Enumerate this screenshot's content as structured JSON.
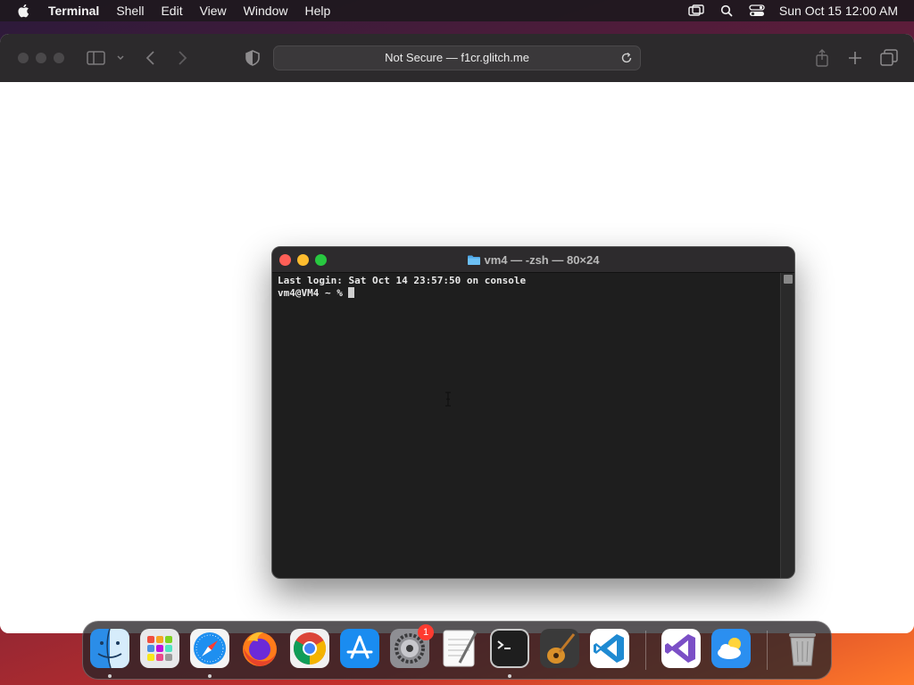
{
  "menubar": {
    "app_name": "Terminal",
    "menus": [
      "Shell",
      "Edit",
      "View",
      "Window",
      "Help"
    ],
    "clock": "Sun Oct 15  12:00 AM",
    "tray_icons": [
      "screen-mirroring-icon",
      "spotlight-icon",
      "control-center-icon"
    ]
  },
  "browser": {
    "address": "Not Secure — f1cr.glitch.me"
  },
  "terminal": {
    "title": "vm4 — -zsh — 80×24",
    "lines": [
      "Last login: Sat Oct 14 23:57:50 on console",
      "vm4@VM4 ~ % "
    ]
  },
  "dock": {
    "apps": [
      {
        "name": "Finder",
        "icon": "finder-icon",
        "running": true
      },
      {
        "name": "Launchpad",
        "icon": "launchpad-icon",
        "running": false
      },
      {
        "name": "Safari",
        "icon": "safari-icon",
        "running": true
      },
      {
        "name": "Firefox",
        "icon": "firefox-icon",
        "running": false
      },
      {
        "name": "Google Chrome",
        "icon": "chrome-icon",
        "running": false
      },
      {
        "name": "App Store",
        "icon": "app-store-icon",
        "running": false
      },
      {
        "name": "System Settings",
        "icon": "system-settings-icon",
        "running": false,
        "badge": "1"
      },
      {
        "name": "TextEdit",
        "icon": "textedit-icon",
        "running": false
      },
      {
        "name": "Terminal",
        "icon": "terminal-icon",
        "running": true
      },
      {
        "name": "GarageBand",
        "icon": "garageband-icon",
        "running": false
      },
      {
        "name": "Visual Studio Code",
        "icon": "vscode-icon",
        "running": false
      },
      {
        "name": "Visual Studio",
        "icon": "visual-studio-icon",
        "running": false
      },
      {
        "name": "Weather",
        "icon": "weather-icon",
        "running": false
      },
      {
        "name": "Trash",
        "icon": "trash-icon",
        "running": false
      }
    ]
  }
}
